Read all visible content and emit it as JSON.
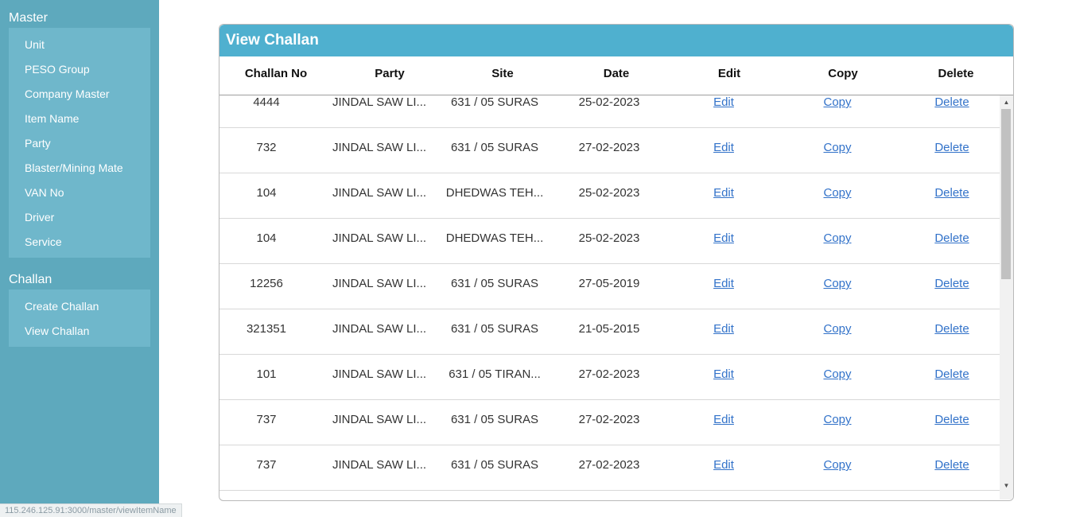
{
  "sidebar": {
    "master_title": "Master",
    "master_items": [
      "Unit",
      "PESO Group",
      "Company Master",
      "Item Name",
      "Party",
      "Blaster/Mining Mate",
      "VAN No",
      "Driver",
      "Service"
    ],
    "challan_title": "Challan",
    "challan_items": [
      "Create Challan",
      "View Challan"
    ]
  },
  "panel": {
    "title": "View Challan",
    "columns": [
      "Challan No",
      "Party",
      "Site",
      "Date",
      "Edit",
      "Copy",
      "Delete"
    ],
    "rows": [
      {
        "challan_no": "4444",
        "party": "JINDAL SAW LI...",
        "site": "631 / 05 SURAS",
        "date": "25-02-2023",
        "edit": "Edit",
        "copy": "Copy",
        "delete": "Delete"
      },
      {
        "challan_no": "732",
        "party": "JINDAL SAW LI...",
        "site": "631 / 05 SURAS",
        "date": "27-02-2023",
        "edit": "Edit",
        "copy": "Copy",
        "delete": "Delete"
      },
      {
        "challan_no": "104",
        "party": "JINDAL SAW LI...",
        "site": "DHEDWAS TEH...",
        "date": "25-02-2023",
        "edit": "Edit",
        "copy": "Copy",
        "delete": "Delete"
      },
      {
        "challan_no": "104",
        "party": "JINDAL SAW LI...",
        "site": "DHEDWAS TEH...",
        "date": "25-02-2023",
        "edit": "Edit",
        "copy": "Copy",
        "delete": "Delete"
      },
      {
        "challan_no": "12256",
        "party": "JINDAL SAW LI...",
        "site": "631 / 05 SURAS",
        "date": "27-05-2019",
        "edit": "Edit",
        "copy": "Copy",
        "delete": "Delete"
      },
      {
        "challan_no": "321351",
        "party": "JINDAL SAW LI...",
        "site": "631 / 05 SURAS",
        "date": "21-05-2015",
        "edit": "Edit",
        "copy": "Copy",
        "delete": "Delete"
      },
      {
        "challan_no": "101",
        "party": "JINDAL SAW LI...",
        "site": "631 / 05 TIRAN...",
        "date": "27-02-2023",
        "edit": "Edit",
        "copy": "Copy",
        "delete": "Delete"
      },
      {
        "challan_no": "737",
        "party": "JINDAL SAW LI...",
        "site": "631 / 05 SURAS",
        "date": "27-02-2023",
        "edit": "Edit",
        "copy": "Copy",
        "delete": "Delete"
      },
      {
        "challan_no": "737",
        "party": "JINDAL SAW LI...",
        "site": "631 / 05 SURAS",
        "date": "27-02-2023",
        "edit": "Edit",
        "copy": "Copy",
        "delete": "Delete"
      }
    ]
  },
  "status_bar": {
    "url": "115.246.125.91:3000/master/viewItemName"
  },
  "colors": {
    "sidebar_bg": "#5ea9bd",
    "menu_box_bg": "#6fb7cb",
    "panel_header_bg": "#4fb0cf",
    "link": "#3272c9"
  },
  "icons": {
    "scroll_up": "triangle-up-icon",
    "scroll_down": "triangle-down-icon"
  }
}
